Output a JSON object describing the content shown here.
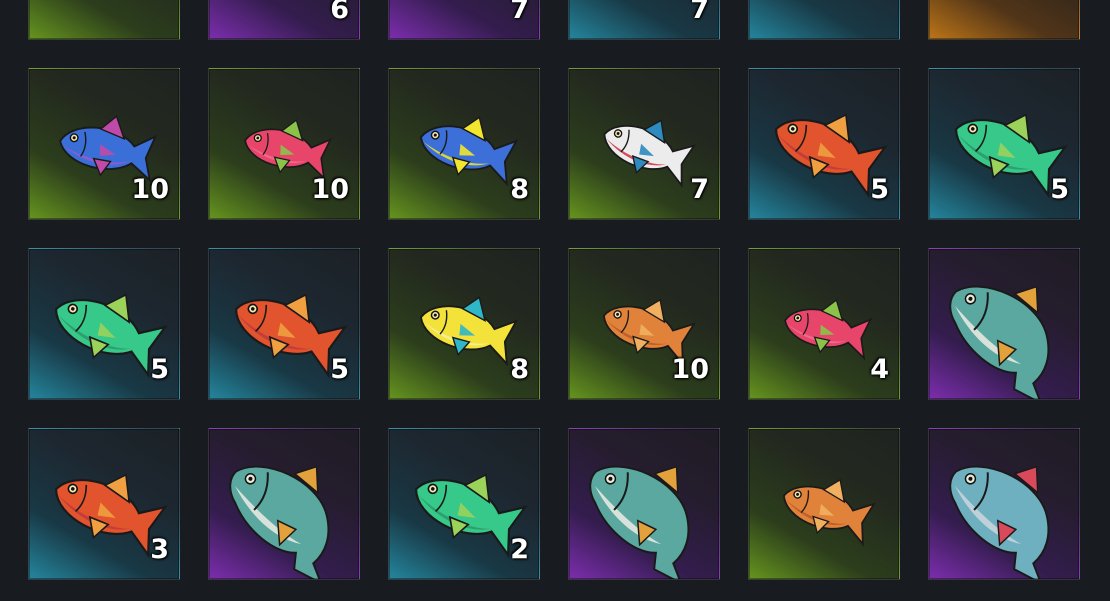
{
  "inventory": {
    "rows": [
      {
        "slots": [
          {
            "item": "fishing-rod-icon",
            "rarity": "green",
            "quantity": ""
          },
          {
            "item": "sack-icon",
            "rarity": "purple",
            "quantity": "6"
          },
          {
            "item": "pie-icon",
            "rarity": "purple",
            "quantity": "7"
          },
          {
            "item": "scroll-icon",
            "rarity": "blue",
            "quantity": "7"
          },
          {
            "item": "ring-icon",
            "rarity": "blue",
            "quantity": ""
          },
          {
            "item": "horn-icon",
            "rarity": "orange",
            "quantity": ""
          }
        ]
      },
      {
        "slots": [
          {
            "item": "blue-fish-icon",
            "rarity": "green",
            "quantity": "10"
          },
          {
            "item": "pink-fish-icon",
            "rarity": "green",
            "quantity": "10"
          },
          {
            "item": "blue-yellow-fish-icon",
            "rarity": "green",
            "quantity": "8"
          },
          {
            "item": "angelfish-icon",
            "rarity": "green",
            "quantity": "7"
          },
          {
            "item": "red-snapper-icon",
            "rarity": "blue",
            "quantity": "5"
          },
          {
            "item": "green-fish-icon",
            "rarity": "blue",
            "quantity": "5"
          }
        ]
      },
      {
        "slots": [
          {
            "item": "green-fish-icon",
            "rarity": "blue",
            "quantity": "5"
          },
          {
            "item": "red-snapper-icon",
            "rarity": "blue",
            "quantity": "5"
          },
          {
            "item": "yellow-angelfish-icon",
            "rarity": "green",
            "quantity": "8"
          },
          {
            "item": "orange-fish-icon",
            "rarity": "green",
            "quantity": "10"
          },
          {
            "item": "pink-fish-icon",
            "rarity": "green",
            "quantity": "4"
          },
          {
            "item": "tarpon-icon",
            "rarity": "purple",
            "quantity": ""
          }
        ]
      },
      {
        "slots": [
          {
            "item": "red-snapper-icon",
            "rarity": "blue",
            "quantity": "3"
          },
          {
            "item": "tarpon-icon",
            "rarity": "purple",
            "quantity": ""
          },
          {
            "item": "green-fish-icon",
            "rarity": "blue",
            "quantity": "2"
          },
          {
            "item": "tarpon-icon",
            "rarity": "purple",
            "quantity": ""
          },
          {
            "item": "orange-fish-icon",
            "rarity": "green",
            "quantity": ""
          },
          {
            "item": "mackerel-icon",
            "rarity": "purple",
            "quantity": ""
          }
        ]
      }
    ]
  },
  "colors": {
    "background": "#181b1f",
    "rarity_green": "#80be1e",
    "rarity_blue": "#28aac8",
    "rarity_purple": "#9632d2",
    "rarity_orange": "#e68c14"
  }
}
